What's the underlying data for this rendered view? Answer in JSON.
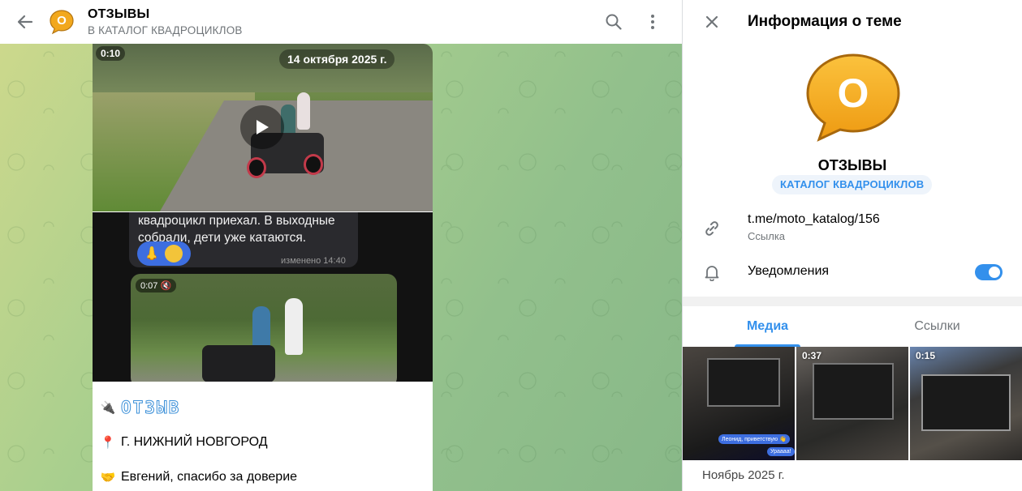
{
  "header": {
    "avatar_letter": "О",
    "title": "ОТЗЫВЫ",
    "subtitle": "В КАТАЛОГ КВАДРОЦИКЛОВ"
  },
  "message": {
    "video_duration": "0:10",
    "date": "14 октября 2025 г.",
    "screenshot": {
      "text": "квадроцикл приехал. В выходные собрали, дети уже катаются.",
      "edited": "изменено 14:40",
      "video_duration": "0:07"
    },
    "lines": [
      {
        "emoji": "🔌",
        "text": "ОТЗЫВ"
      },
      {
        "emoji": "📍",
        "text": "Г. НИЖНИЙ НОВГОРОД"
      },
      {
        "emoji": "🤝",
        "text": "Евгений, спасибо за доверие"
      }
    ]
  },
  "panel": {
    "title": "Информация о теме",
    "avatar_letter": "О",
    "topic_name": "ОТЗЫВЫ",
    "topic_chip": "КАТАЛОГ КВАДРОЦИКЛОВ",
    "link": {
      "value": "t.me/moto_katalog/156",
      "label": "Ссылка"
    },
    "notifications": {
      "label": "Уведомления",
      "enabled": true
    },
    "tabs": [
      {
        "label": "Медиа",
        "active": true
      },
      {
        "label": "Ссылки",
        "active": false
      }
    ],
    "media": [
      {
        "duration": "",
        "chip": "Леонид, приветствую 👋",
        "chip2": "Ураааа!"
      },
      {
        "duration": "0:37"
      },
      {
        "duration": "0:15"
      }
    ],
    "month": "Ноябрь 2025 г."
  },
  "colors": {
    "accent": "#3390ec",
    "avatar": "#f2a81d"
  }
}
